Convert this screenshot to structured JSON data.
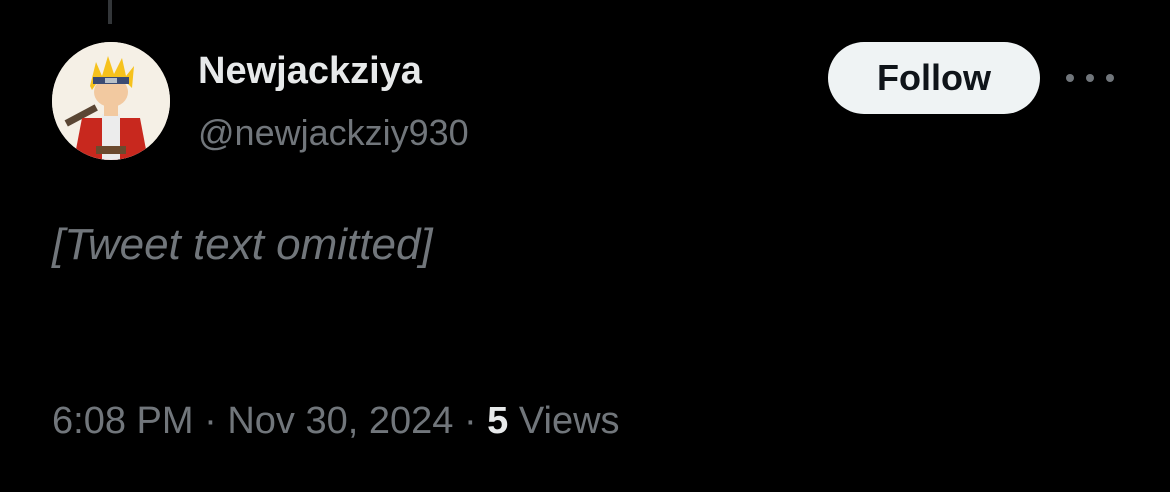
{
  "user": {
    "display_name": "Newjackziya",
    "handle": "@newjackziy930",
    "avatar_icon": "anime-character-avatar"
  },
  "actions": {
    "follow_label": "Follow",
    "more_icon": "more-options-icon"
  },
  "tweet": {
    "text": "[Tweet text omitted]"
  },
  "meta": {
    "time": "6:08 PM",
    "separator": "·",
    "date": "Nov 30, 2024",
    "views_count": "5",
    "views_label": "Views"
  },
  "colors": {
    "background": "#000000",
    "primary_text": "#e7e9ea",
    "secondary_text": "#71767b",
    "follow_bg": "#eff3f4",
    "follow_text": "#0f1419"
  }
}
